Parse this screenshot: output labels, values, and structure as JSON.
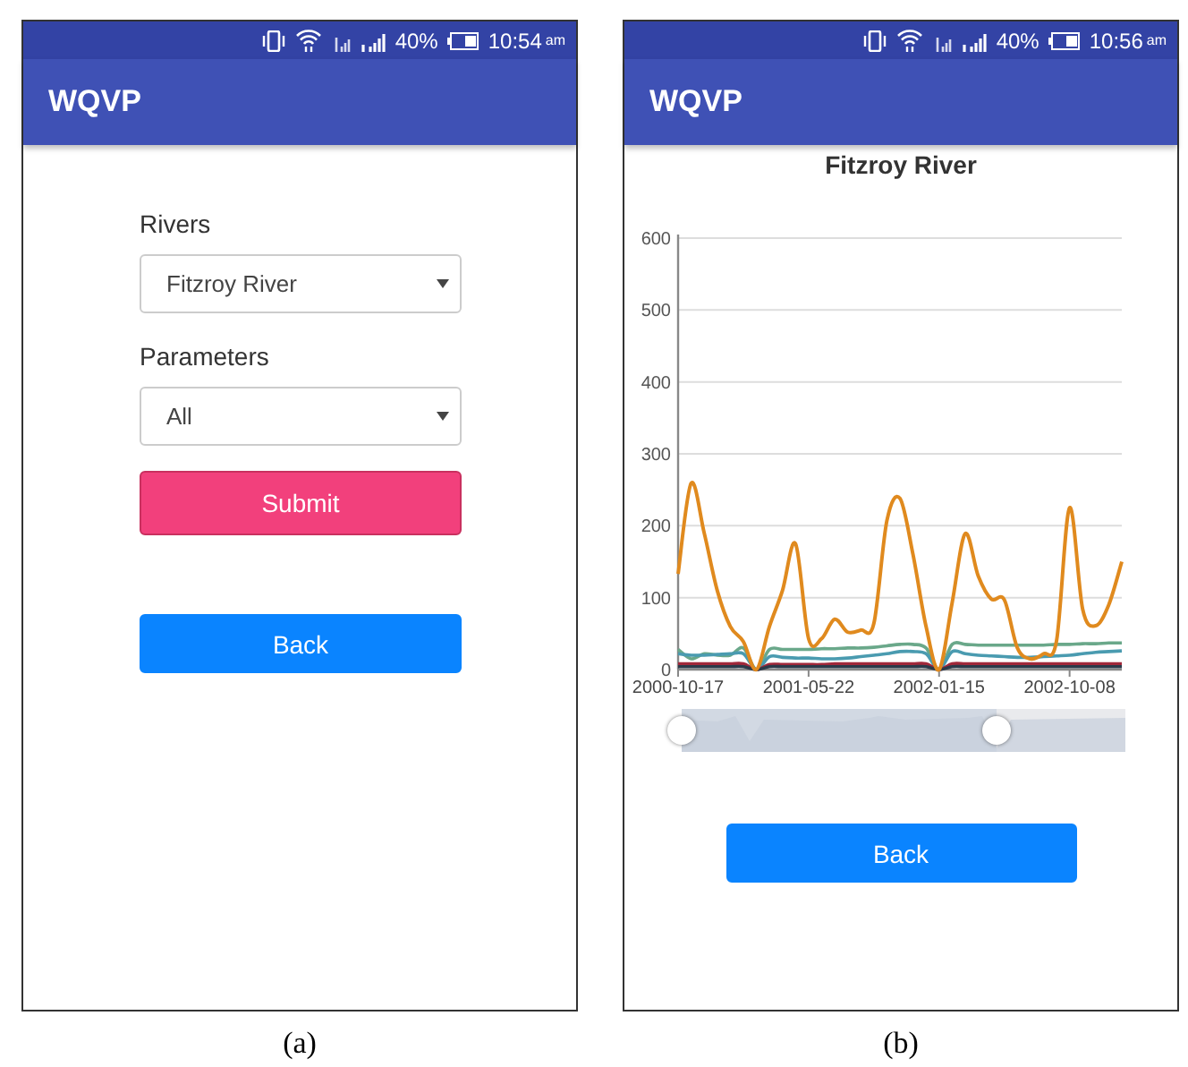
{
  "figures": [
    {
      "caption": "(a)",
      "status_bar": {
        "battery": "40%",
        "time": "10:54",
        "meridiem": "am"
      },
      "app_bar": {
        "title": "WQVP"
      },
      "screen": {
        "kind": "form",
        "fields": [
          {
            "label": "Rivers",
            "value": "Fitzroy River"
          },
          {
            "label": "Parameters",
            "value": "All"
          }
        ],
        "submit": "Submit",
        "back": "Back"
      }
    },
    {
      "caption": "(b)",
      "status_bar": {
        "battery": "40%",
        "time": "10:56",
        "meridiem": "am"
      },
      "app_bar": {
        "title": "WQVP"
      },
      "screen": {
        "kind": "chart",
        "title": "Fitzroy River",
        "chart_data": {
          "type": "line",
          "grid": true,
          "ylim": [
            0,
            600
          ],
          "yticks": [
            0,
            100,
            200,
            300,
            400,
            500,
            600
          ],
          "categories": [
            "2000-10-17",
            null,
            null,
            null,
            null,
            null,
            null,
            null,
            null,
            null,
            "2001-05-22",
            null,
            null,
            null,
            null,
            null,
            null,
            null,
            null,
            null,
            "2002-01-15",
            null,
            null,
            null,
            null,
            null,
            null,
            null,
            null,
            null,
            "2002-10-08",
            null,
            null,
            null,
            null
          ],
          "series": [
            {
              "color": "#6aa88a",
              "values": [
                28,
                15,
                22,
                20,
                20,
                30,
                0,
                28,
                28,
                28,
                28,
                29,
                29,
                30,
                30,
                31,
                33,
                35,
                35,
                30,
                0,
                35,
                35,
                34,
                34,
                34,
                34,
                34,
                34,
                35,
                35,
                36,
                36,
                37,
                37
              ]
            },
            {
              "color": "#4a9bb0",
              "values": [
                22,
                20,
                20,
                21,
                22,
                22,
                0,
                18,
                17,
                16,
                16,
                15,
                15,
                16,
                18,
                20,
                22,
                25,
                25,
                22,
                0,
                25,
                22,
                20,
                19,
                18,
                17,
                17,
                18,
                19,
                20,
                22,
                24,
                25,
                26
              ]
            },
            {
              "color": "#a0283a",
              "values": [
                8,
                8,
                8,
                8,
                8,
                8,
                0,
                7,
                7,
                7,
                7,
                7,
                8,
                8,
                8,
                8,
                8,
                8,
                8,
                8,
                0,
                8,
                8,
                8,
                8,
                8,
                8,
                8,
                8,
                8,
                8,
                8,
                8,
                8,
                8
              ]
            },
            {
              "color": "#2b3a4a",
              "values": [
                4,
                4,
                4,
                4,
                4,
                4,
                0,
                4,
                4,
                4,
                4,
                4,
                4,
                4,
                4,
                4,
                4,
                4,
                4,
                4,
                0,
                4,
                4,
                4,
                4,
                4,
                4,
                4,
                4,
                4,
                4,
                4,
                4,
                4,
                4
              ]
            },
            {
              "color": "#e08a1e",
              "values": [
                133,
                259,
                190,
                110,
                60,
                39,
                0,
                60,
                110,
                175,
                43,
                43,
                70,
                52,
                55,
                64,
                207,
                238,
                160,
                60,
                0,
                93,
                189,
                130,
                98,
                97,
                30,
                15,
                22,
                40,
                225,
                84,
                61,
                90,
                150
              ]
            }
          ]
        },
        "range_slider": {
          "level": 0.71
        },
        "back": "Back"
      }
    }
  ]
}
